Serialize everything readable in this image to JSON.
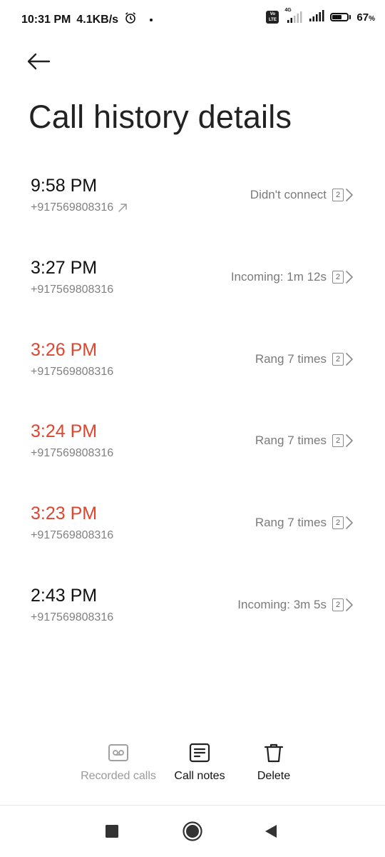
{
  "status_bar": {
    "time": "10:31 PM",
    "speed": "4.1KB/s",
    "volte": "Vo LTE",
    "network": "4G",
    "battery_percent": "67",
    "battery_unit": "%",
    "battery_level": 0.67
  },
  "header": {
    "title": "Call history details"
  },
  "calls": [
    {
      "time": "9:58 PM",
      "number": "+917569808316",
      "status": "Didn't connect",
      "sim": "2",
      "missed": false,
      "outgoing": true
    },
    {
      "time": "3:27 PM",
      "number": "+917569808316",
      "status": "Incoming: 1m 12s",
      "sim": "2",
      "missed": false,
      "outgoing": false
    },
    {
      "time": "3:26 PM",
      "number": "+917569808316",
      "status": "Rang 7 times",
      "sim": "2",
      "missed": true,
      "outgoing": false
    },
    {
      "time": "3:24 PM",
      "number": "+917569808316",
      "status": "Rang 7 times",
      "sim": "2",
      "missed": true,
      "outgoing": false
    },
    {
      "time": "3:23 PM",
      "number": "+917569808316",
      "status": "Rang 7 times",
      "sim": "2",
      "missed": true,
      "outgoing": false
    },
    {
      "time": "2:43 PM",
      "number": "+917569808316",
      "status": "Incoming: 3m 5s",
      "sim": "2",
      "missed": false,
      "outgoing": false
    }
  ],
  "actions": {
    "recorded_calls": "Recorded calls",
    "call_notes": "Call notes",
    "delete": "Delete"
  },
  "colors": {
    "missed": "#e0452f",
    "secondary_text": "#808080"
  }
}
